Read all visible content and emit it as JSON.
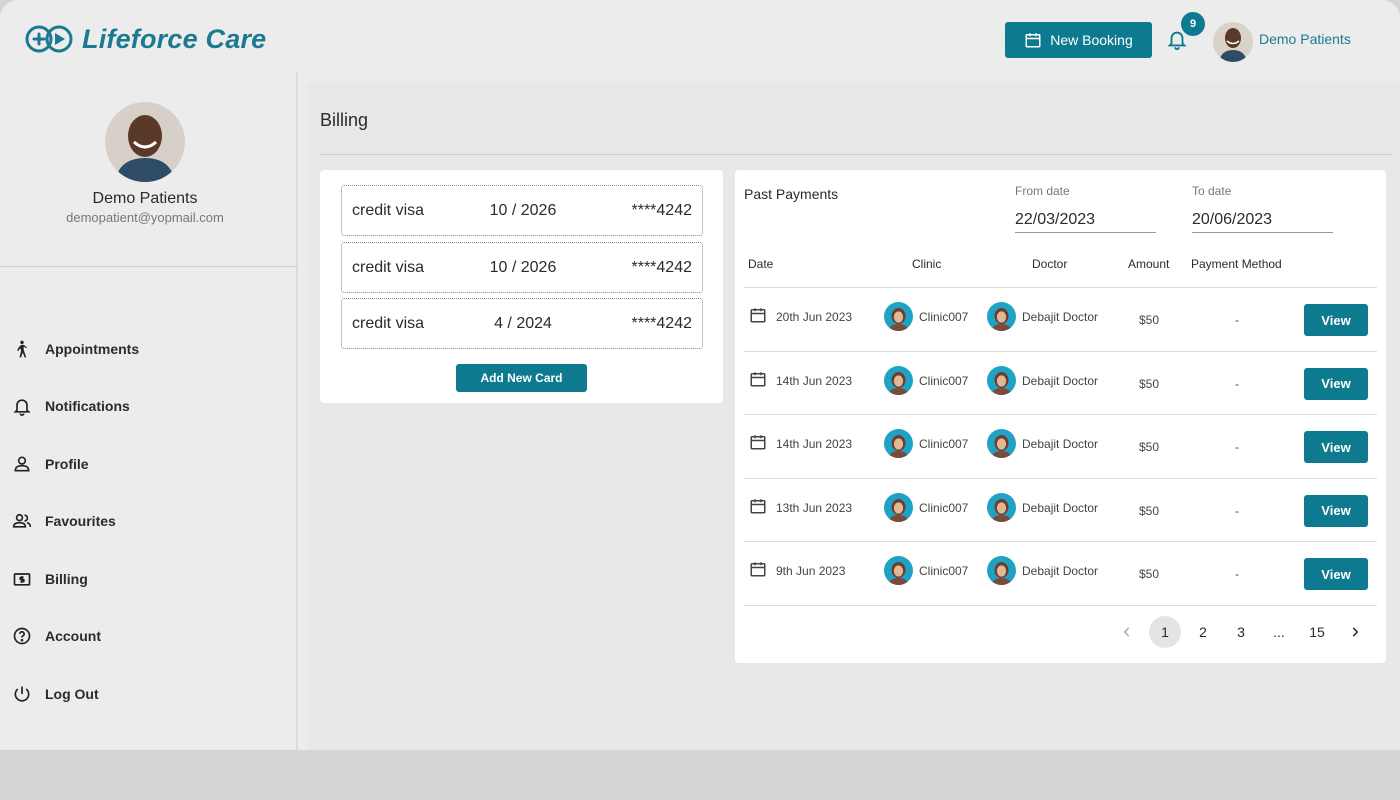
{
  "app": {
    "brand": "Lifeforce Care",
    "colors": {
      "primary": "#0e7a8f",
      "brand_text": "#1b7a91"
    }
  },
  "header": {
    "new_booking_label": "New Booking",
    "notification_count": "9",
    "user_name": "Demo Patients"
  },
  "sidebar": {
    "profile_name": "Demo Patients",
    "profile_email": "demopatient@yopmail.com",
    "items": [
      {
        "label": "Appointments",
        "icon": "walking-person-icon"
      },
      {
        "label": "Notifications",
        "icon": "bell-icon"
      },
      {
        "label": "Profile",
        "icon": "person-icon"
      },
      {
        "label": "Favourites",
        "icon": "people-icon"
      },
      {
        "label": "Billing",
        "icon": "dollar-bill-icon"
      },
      {
        "label": "Account",
        "icon": "help-circle-icon"
      },
      {
        "label": "Log Out",
        "icon": "power-icon"
      }
    ]
  },
  "main": {
    "title": "Billing",
    "cards": [
      {
        "type": "credit visa",
        "expiry": "10 / 2026",
        "number": "****4242"
      },
      {
        "type": "credit visa",
        "expiry": "10 / 2026",
        "number": "****4242"
      },
      {
        "type": "credit visa",
        "expiry": "4 / 2024",
        "number": "****4242"
      }
    ],
    "add_card_label": "Add New Card",
    "payments": {
      "title": "Past Payments",
      "from_label": "From date",
      "from_value": "22/03/2023",
      "to_label": "To date",
      "to_value": "20/06/2023",
      "columns": [
        "Date",
        "Clinic",
        "Doctor",
        "Amount",
        "Payment Method"
      ],
      "rows": [
        {
          "date": "20th Jun 2023",
          "clinic": "Clinic007",
          "doctor": "Debajit Doctor",
          "amount": "$50",
          "method": "-",
          "action": "View"
        },
        {
          "date": "14th Jun 2023",
          "clinic": "Clinic007",
          "doctor": "Debajit Doctor",
          "amount": "$50",
          "method": "-",
          "action": "View"
        },
        {
          "date": "14th Jun 2023",
          "clinic": "Clinic007",
          "doctor": "Debajit Doctor",
          "amount": "$50",
          "method": "-",
          "action": "View"
        },
        {
          "date": "13th Jun 2023",
          "clinic": "Clinic007",
          "doctor": "Debajit Doctor",
          "amount": "$50",
          "method": "-",
          "action": "View"
        },
        {
          "date": "9th Jun 2023",
          "clinic": "Clinic007",
          "doctor": "Debajit Doctor",
          "amount": "$50",
          "method": "-",
          "action": "View"
        }
      ],
      "pagination": {
        "pages": [
          "1",
          "2",
          "3",
          "...",
          "15"
        ],
        "current": "1"
      }
    }
  }
}
